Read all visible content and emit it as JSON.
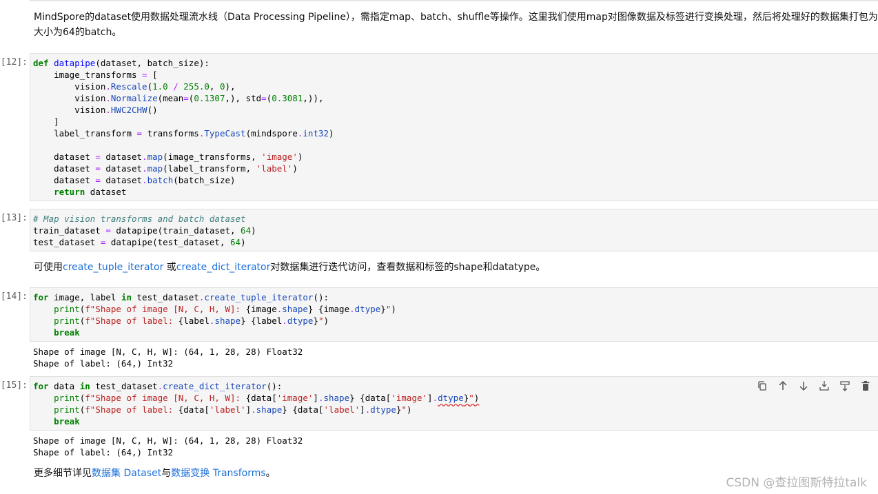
{
  "intro": {
    "line1": "MindSpore的dataset使用数据处理流水线（Data Processing Pipeline），需指定map、batch、shuffle等操作。这里我们使用map对图像数据及标签进行变换处理，然后将处理好的数据集打包为",
    "line2": "大小为64的batch。"
  },
  "cells": [
    {
      "prompt": "[12]:"
    },
    {
      "prompt": "[13]:"
    },
    {
      "prompt": "[14]:"
    },
    {
      "prompt": "[15]:"
    }
  ],
  "iter_text": {
    "pre": "可使用",
    "link1": "create_tuple_iterator",
    "mid": " 或",
    "link2": "create_dict_iterator",
    "post": "对数据集进行迭代访问，查看数据和标签的shape和datatype。"
  },
  "outputs": {
    "out14": [
      "Shape of image [N, C, H, W]: (64, 1, 28, 28) Float32",
      "Shape of label: (64,) Int32"
    ],
    "out15": [
      "Shape of image [N, C, H, W]: (64, 1, 28, 28) Float32",
      "Shape of label: (64,) Int32"
    ]
  },
  "footer": {
    "pre": "更多细节详见",
    "link1": "数据集 Dataset",
    "mid": "与",
    "link2": "数据变换 Transforms",
    "post": "。"
  },
  "toolbar_icons": [
    "duplicate-icon",
    "move-up-icon",
    "move-down-icon",
    "insert-above-icon",
    "insert-below-icon",
    "delete-icon"
  ],
  "watermark": "CSDN @查拉图斯特拉talk"
}
